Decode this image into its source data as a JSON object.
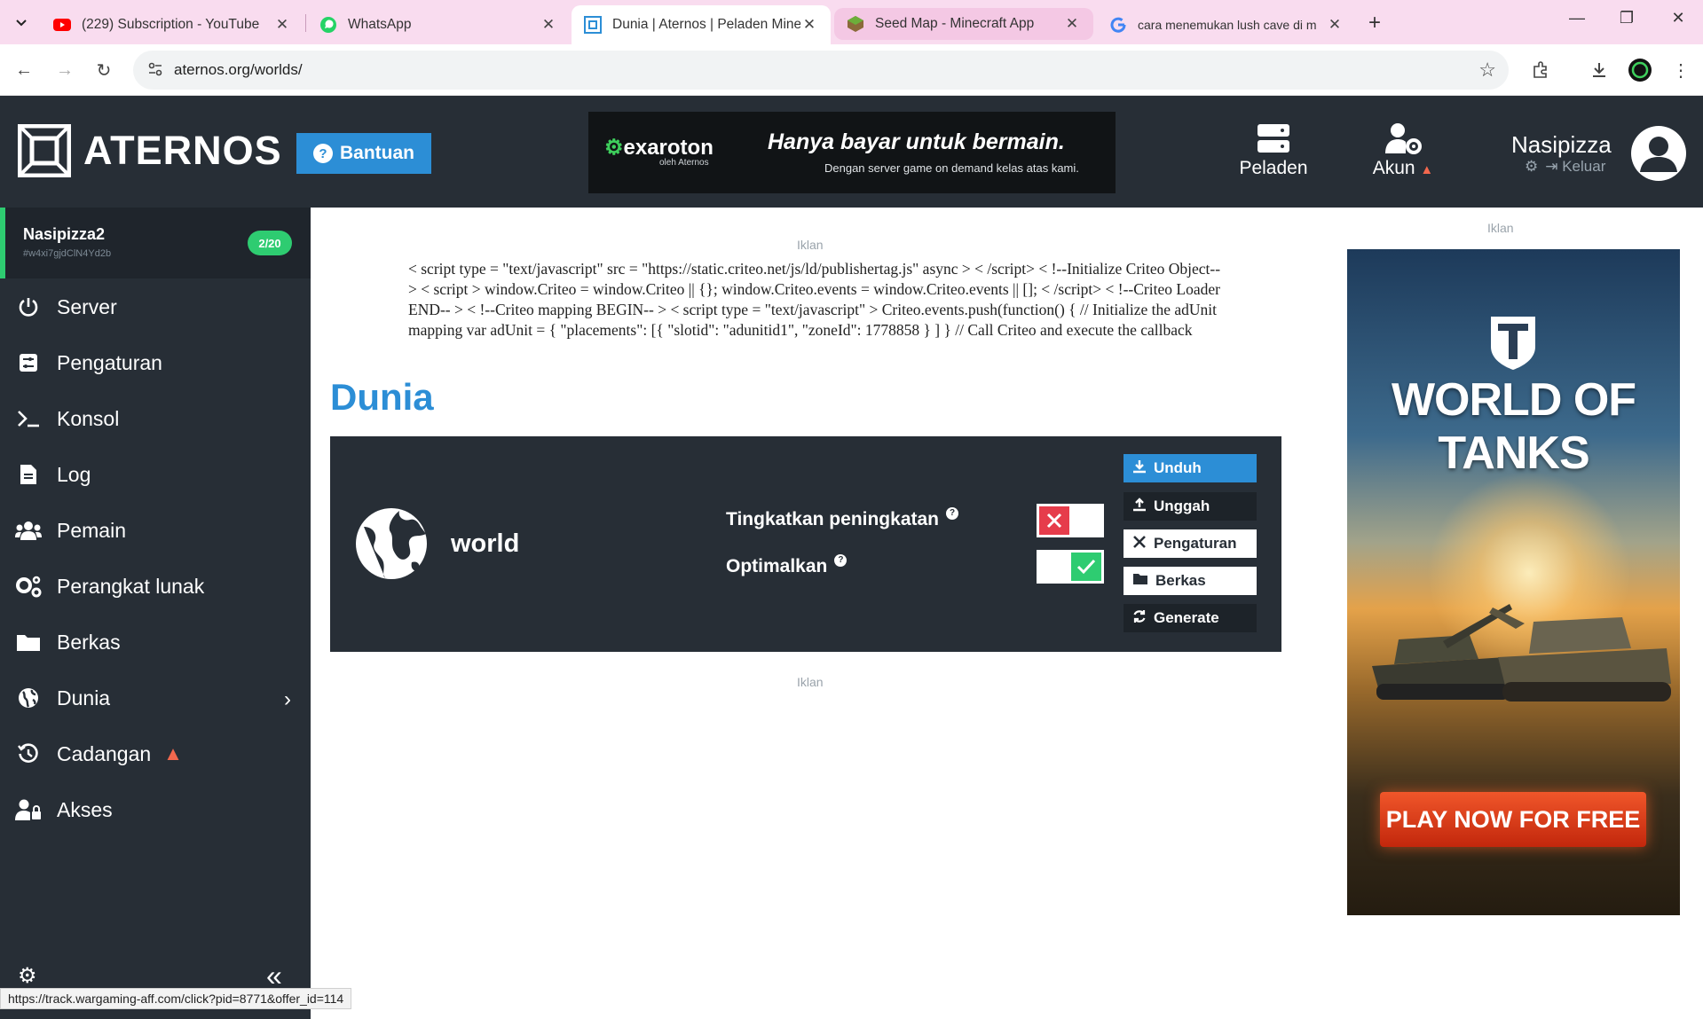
{
  "browser": {
    "tabs": [
      {
        "title": "(229) Subscription - YouTube",
        "icon": "youtube-icon"
      },
      {
        "title": "WhatsApp",
        "icon": "whatsapp-icon"
      },
      {
        "title": "Dunia | Aternos | Peladen Minec",
        "icon": "aternos-icon"
      },
      {
        "title": "Seed Map - Minecraft App",
        "icon": "seedmap-icon"
      },
      {
        "title": "cara menemukan lush cave di m",
        "icon": "google-icon"
      }
    ],
    "url": "aternos.org/worlds/"
  },
  "header": {
    "logo_text": "ATERNOS",
    "help_label": "Bantuan",
    "banner": {
      "brand": "exaroton",
      "brand_sub": "oleh Aternos",
      "headline": "Hanya bayar untuk bermain.",
      "tagline": "Dengan server game on demand kelas atas kami."
    },
    "nav_servers": "Peladen",
    "nav_account": "Akun",
    "user_name": "Nasipizza",
    "logout_label": "Keluar"
  },
  "sidebar": {
    "server_name": "Nasipizza2",
    "server_id": "#w4xi7gjdClN4Yd2b",
    "player_badge": "2/20",
    "items": [
      {
        "label": "Server"
      },
      {
        "label": "Pengaturan"
      },
      {
        "label": "Konsol"
      },
      {
        "label": "Log"
      },
      {
        "label": "Pemain"
      },
      {
        "label": "Perangkat lunak"
      },
      {
        "label": "Berkas"
      },
      {
        "label": "Dunia"
      },
      {
        "label": "Cadangan"
      },
      {
        "label": "Akses"
      }
    ]
  },
  "main": {
    "ad_label": "Iklan",
    "ad_script_text": "< script type = \"text/javascript\" src = \"https://static.criteo.net/js/ld/publishertag.js\" async > < /script> < !--Initialize Criteo Object-- > < script > window.Criteo = window.Criteo || {}; window.Criteo.events = window.Criteo.events || []; < /script> < !--Criteo Loader END-- > < !--Criteo mapping BEGIN-- > < script type = \"text/javascript\" > Criteo.events.push(function() { // Initialize the adUnit mapping var adUnit = { \"placements\": [{ \"slotid\": \"adunitid1\", \"zoneId\": 1778858 } ] } // Call Criteo and execute the callback function for a given",
    "title": "Dunia",
    "world": {
      "name": "world",
      "option_upgrade": "Tingkatkan peningkatan",
      "option_optimize": "Optimalkan",
      "upgrade_enabled": false,
      "optimize_enabled": true,
      "actions": {
        "download": "Unduh",
        "upload": "Unggah",
        "settings": "Pengaturan",
        "files": "Berkas",
        "generate": "Generate"
      }
    },
    "ad_label_bottom": "Iklan"
  },
  "right_ad": {
    "label": "Iklan",
    "title": "WORLD OF TANKS",
    "cta": "PLAY NOW FOR FREE"
  },
  "status_bar": {
    "url": "https://track.wargaming-aff.com/click?pid=8771&offer_id=114"
  },
  "colors": {
    "accent_blue": "#2c8ed6",
    "dark_bg": "#272e36",
    "success_green": "#2ecc71",
    "danger_red": "#e63c4b",
    "warning_orange": "#f2684e"
  }
}
